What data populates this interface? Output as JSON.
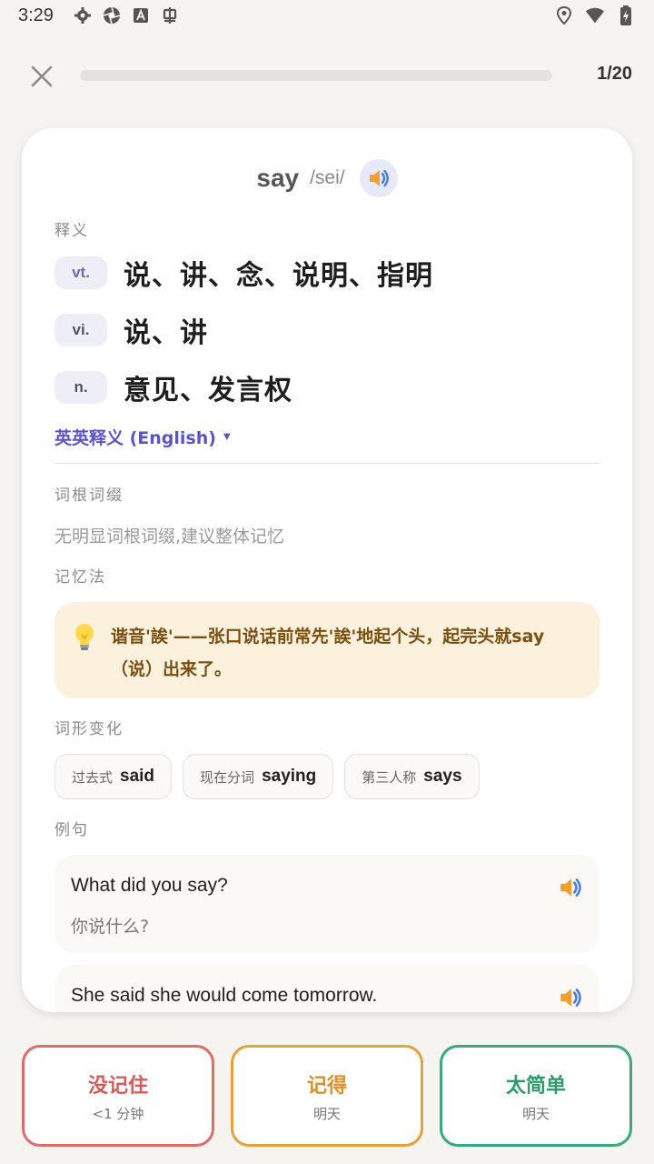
{
  "status_bar": {
    "time": "3:29",
    "icons_left": [
      "gear-icon",
      "aperture-icon",
      "font-a-icon",
      "bug-icon"
    ],
    "icons_right": [
      "location-icon",
      "wifi-icon",
      "battery-charging-icon"
    ]
  },
  "header": {
    "close_icon": "close-icon",
    "progress_fraction": 0.0,
    "counter": "1/20"
  },
  "word": {
    "text": "say",
    "phonetic": "/sei/"
  },
  "labels": {
    "definition": "释义",
    "roots": "词根词缀",
    "mnemonic": "记忆法",
    "forms": "词形变化",
    "examples": "例句"
  },
  "definitions": [
    {
      "pos": "vt.",
      "meaning": "说、讲、念、说明、指明"
    },
    {
      "pos": "vi.",
      "meaning": "说、讲"
    },
    {
      "pos": "n.",
      "meaning": "意见、发言权"
    }
  ],
  "english_toggle": "英英释义 (English)",
  "roots_text": "无明显词根词缀,建议整体记忆",
  "mnemonic_text": "谐音'誒'——张口说话前常先'誒'地起个头，起完头就say（说）出来了。",
  "forms": [
    {
      "label": "过去式",
      "value": "said"
    },
    {
      "label": "现在分词",
      "value": "saying"
    },
    {
      "label": "第三人称",
      "value": "says"
    }
  ],
  "examples": [
    {
      "en": "What did you say?",
      "zh": "你说什么?"
    },
    {
      "en": "She said she would come tomorrow.",
      "zh": ""
    }
  ],
  "buttons": {
    "forgot": {
      "label": "没记住",
      "sub": "<1 分钟"
    },
    "remember": {
      "label": "记得",
      "sub": "明天"
    },
    "easy": {
      "label": "太简单",
      "sub": "明天"
    }
  },
  "colors": {
    "accent": "#5a54c8",
    "forgot": "#d65a5a",
    "remember": "#d9902a",
    "easy": "#2f9a6a",
    "memo_bg": "#fbf1dd"
  }
}
